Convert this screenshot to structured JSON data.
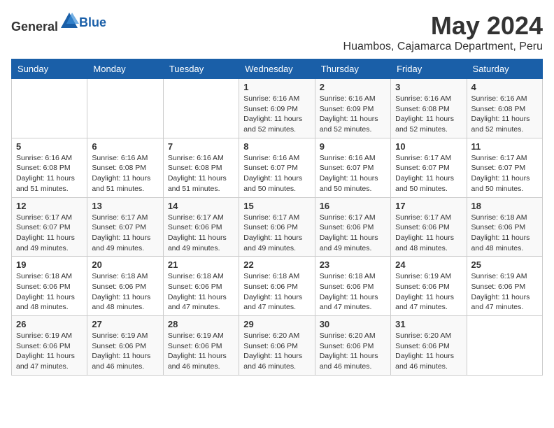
{
  "header": {
    "logo_general": "General",
    "logo_blue": "Blue",
    "title": "May 2024",
    "subtitle": "Huambos, Cajamarca Department, Peru"
  },
  "weekdays": [
    "Sunday",
    "Monday",
    "Tuesday",
    "Wednesday",
    "Thursday",
    "Friday",
    "Saturday"
  ],
  "weeks": [
    [
      {
        "day": "",
        "info": ""
      },
      {
        "day": "",
        "info": ""
      },
      {
        "day": "",
        "info": ""
      },
      {
        "day": "1",
        "info": "Sunrise: 6:16 AM\nSunset: 6:09 PM\nDaylight: 11 hours and 52 minutes."
      },
      {
        "day": "2",
        "info": "Sunrise: 6:16 AM\nSunset: 6:09 PM\nDaylight: 11 hours and 52 minutes."
      },
      {
        "day": "3",
        "info": "Sunrise: 6:16 AM\nSunset: 6:08 PM\nDaylight: 11 hours and 52 minutes."
      },
      {
        "day": "4",
        "info": "Sunrise: 6:16 AM\nSunset: 6:08 PM\nDaylight: 11 hours and 52 minutes."
      }
    ],
    [
      {
        "day": "5",
        "info": "Sunrise: 6:16 AM\nSunset: 6:08 PM\nDaylight: 11 hours and 51 minutes."
      },
      {
        "day": "6",
        "info": "Sunrise: 6:16 AM\nSunset: 6:08 PM\nDaylight: 11 hours and 51 minutes."
      },
      {
        "day": "7",
        "info": "Sunrise: 6:16 AM\nSunset: 6:08 PM\nDaylight: 11 hours and 51 minutes."
      },
      {
        "day": "8",
        "info": "Sunrise: 6:16 AM\nSunset: 6:07 PM\nDaylight: 11 hours and 50 minutes."
      },
      {
        "day": "9",
        "info": "Sunrise: 6:16 AM\nSunset: 6:07 PM\nDaylight: 11 hours and 50 minutes."
      },
      {
        "day": "10",
        "info": "Sunrise: 6:17 AM\nSunset: 6:07 PM\nDaylight: 11 hours and 50 minutes."
      },
      {
        "day": "11",
        "info": "Sunrise: 6:17 AM\nSunset: 6:07 PM\nDaylight: 11 hours and 50 minutes."
      }
    ],
    [
      {
        "day": "12",
        "info": "Sunrise: 6:17 AM\nSunset: 6:07 PM\nDaylight: 11 hours and 49 minutes."
      },
      {
        "day": "13",
        "info": "Sunrise: 6:17 AM\nSunset: 6:07 PM\nDaylight: 11 hours and 49 minutes."
      },
      {
        "day": "14",
        "info": "Sunrise: 6:17 AM\nSunset: 6:06 PM\nDaylight: 11 hours and 49 minutes."
      },
      {
        "day": "15",
        "info": "Sunrise: 6:17 AM\nSunset: 6:06 PM\nDaylight: 11 hours and 49 minutes."
      },
      {
        "day": "16",
        "info": "Sunrise: 6:17 AM\nSunset: 6:06 PM\nDaylight: 11 hours and 49 minutes."
      },
      {
        "day": "17",
        "info": "Sunrise: 6:17 AM\nSunset: 6:06 PM\nDaylight: 11 hours and 48 minutes."
      },
      {
        "day": "18",
        "info": "Sunrise: 6:18 AM\nSunset: 6:06 PM\nDaylight: 11 hours and 48 minutes."
      }
    ],
    [
      {
        "day": "19",
        "info": "Sunrise: 6:18 AM\nSunset: 6:06 PM\nDaylight: 11 hours and 48 minutes."
      },
      {
        "day": "20",
        "info": "Sunrise: 6:18 AM\nSunset: 6:06 PM\nDaylight: 11 hours and 48 minutes."
      },
      {
        "day": "21",
        "info": "Sunrise: 6:18 AM\nSunset: 6:06 PM\nDaylight: 11 hours and 47 minutes."
      },
      {
        "day": "22",
        "info": "Sunrise: 6:18 AM\nSunset: 6:06 PM\nDaylight: 11 hours and 47 minutes."
      },
      {
        "day": "23",
        "info": "Sunrise: 6:18 AM\nSunset: 6:06 PM\nDaylight: 11 hours and 47 minutes."
      },
      {
        "day": "24",
        "info": "Sunrise: 6:19 AM\nSunset: 6:06 PM\nDaylight: 11 hours and 47 minutes."
      },
      {
        "day": "25",
        "info": "Sunrise: 6:19 AM\nSunset: 6:06 PM\nDaylight: 11 hours and 47 minutes."
      }
    ],
    [
      {
        "day": "26",
        "info": "Sunrise: 6:19 AM\nSunset: 6:06 PM\nDaylight: 11 hours and 47 minutes."
      },
      {
        "day": "27",
        "info": "Sunrise: 6:19 AM\nSunset: 6:06 PM\nDaylight: 11 hours and 46 minutes."
      },
      {
        "day": "28",
        "info": "Sunrise: 6:19 AM\nSunset: 6:06 PM\nDaylight: 11 hours and 46 minutes."
      },
      {
        "day": "29",
        "info": "Sunrise: 6:20 AM\nSunset: 6:06 PM\nDaylight: 11 hours and 46 minutes."
      },
      {
        "day": "30",
        "info": "Sunrise: 6:20 AM\nSunset: 6:06 PM\nDaylight: 11 hours and 46 minutes."
      },
      {
        "day": "31",
        "info": "Sunrise: 6:20 AM\nSunset: 6:06 PM\nDaylight: 11 hours and 46 minutes."
      },
      {
        "day": "",
        "info": ""
      }
    ]
  ]
}
